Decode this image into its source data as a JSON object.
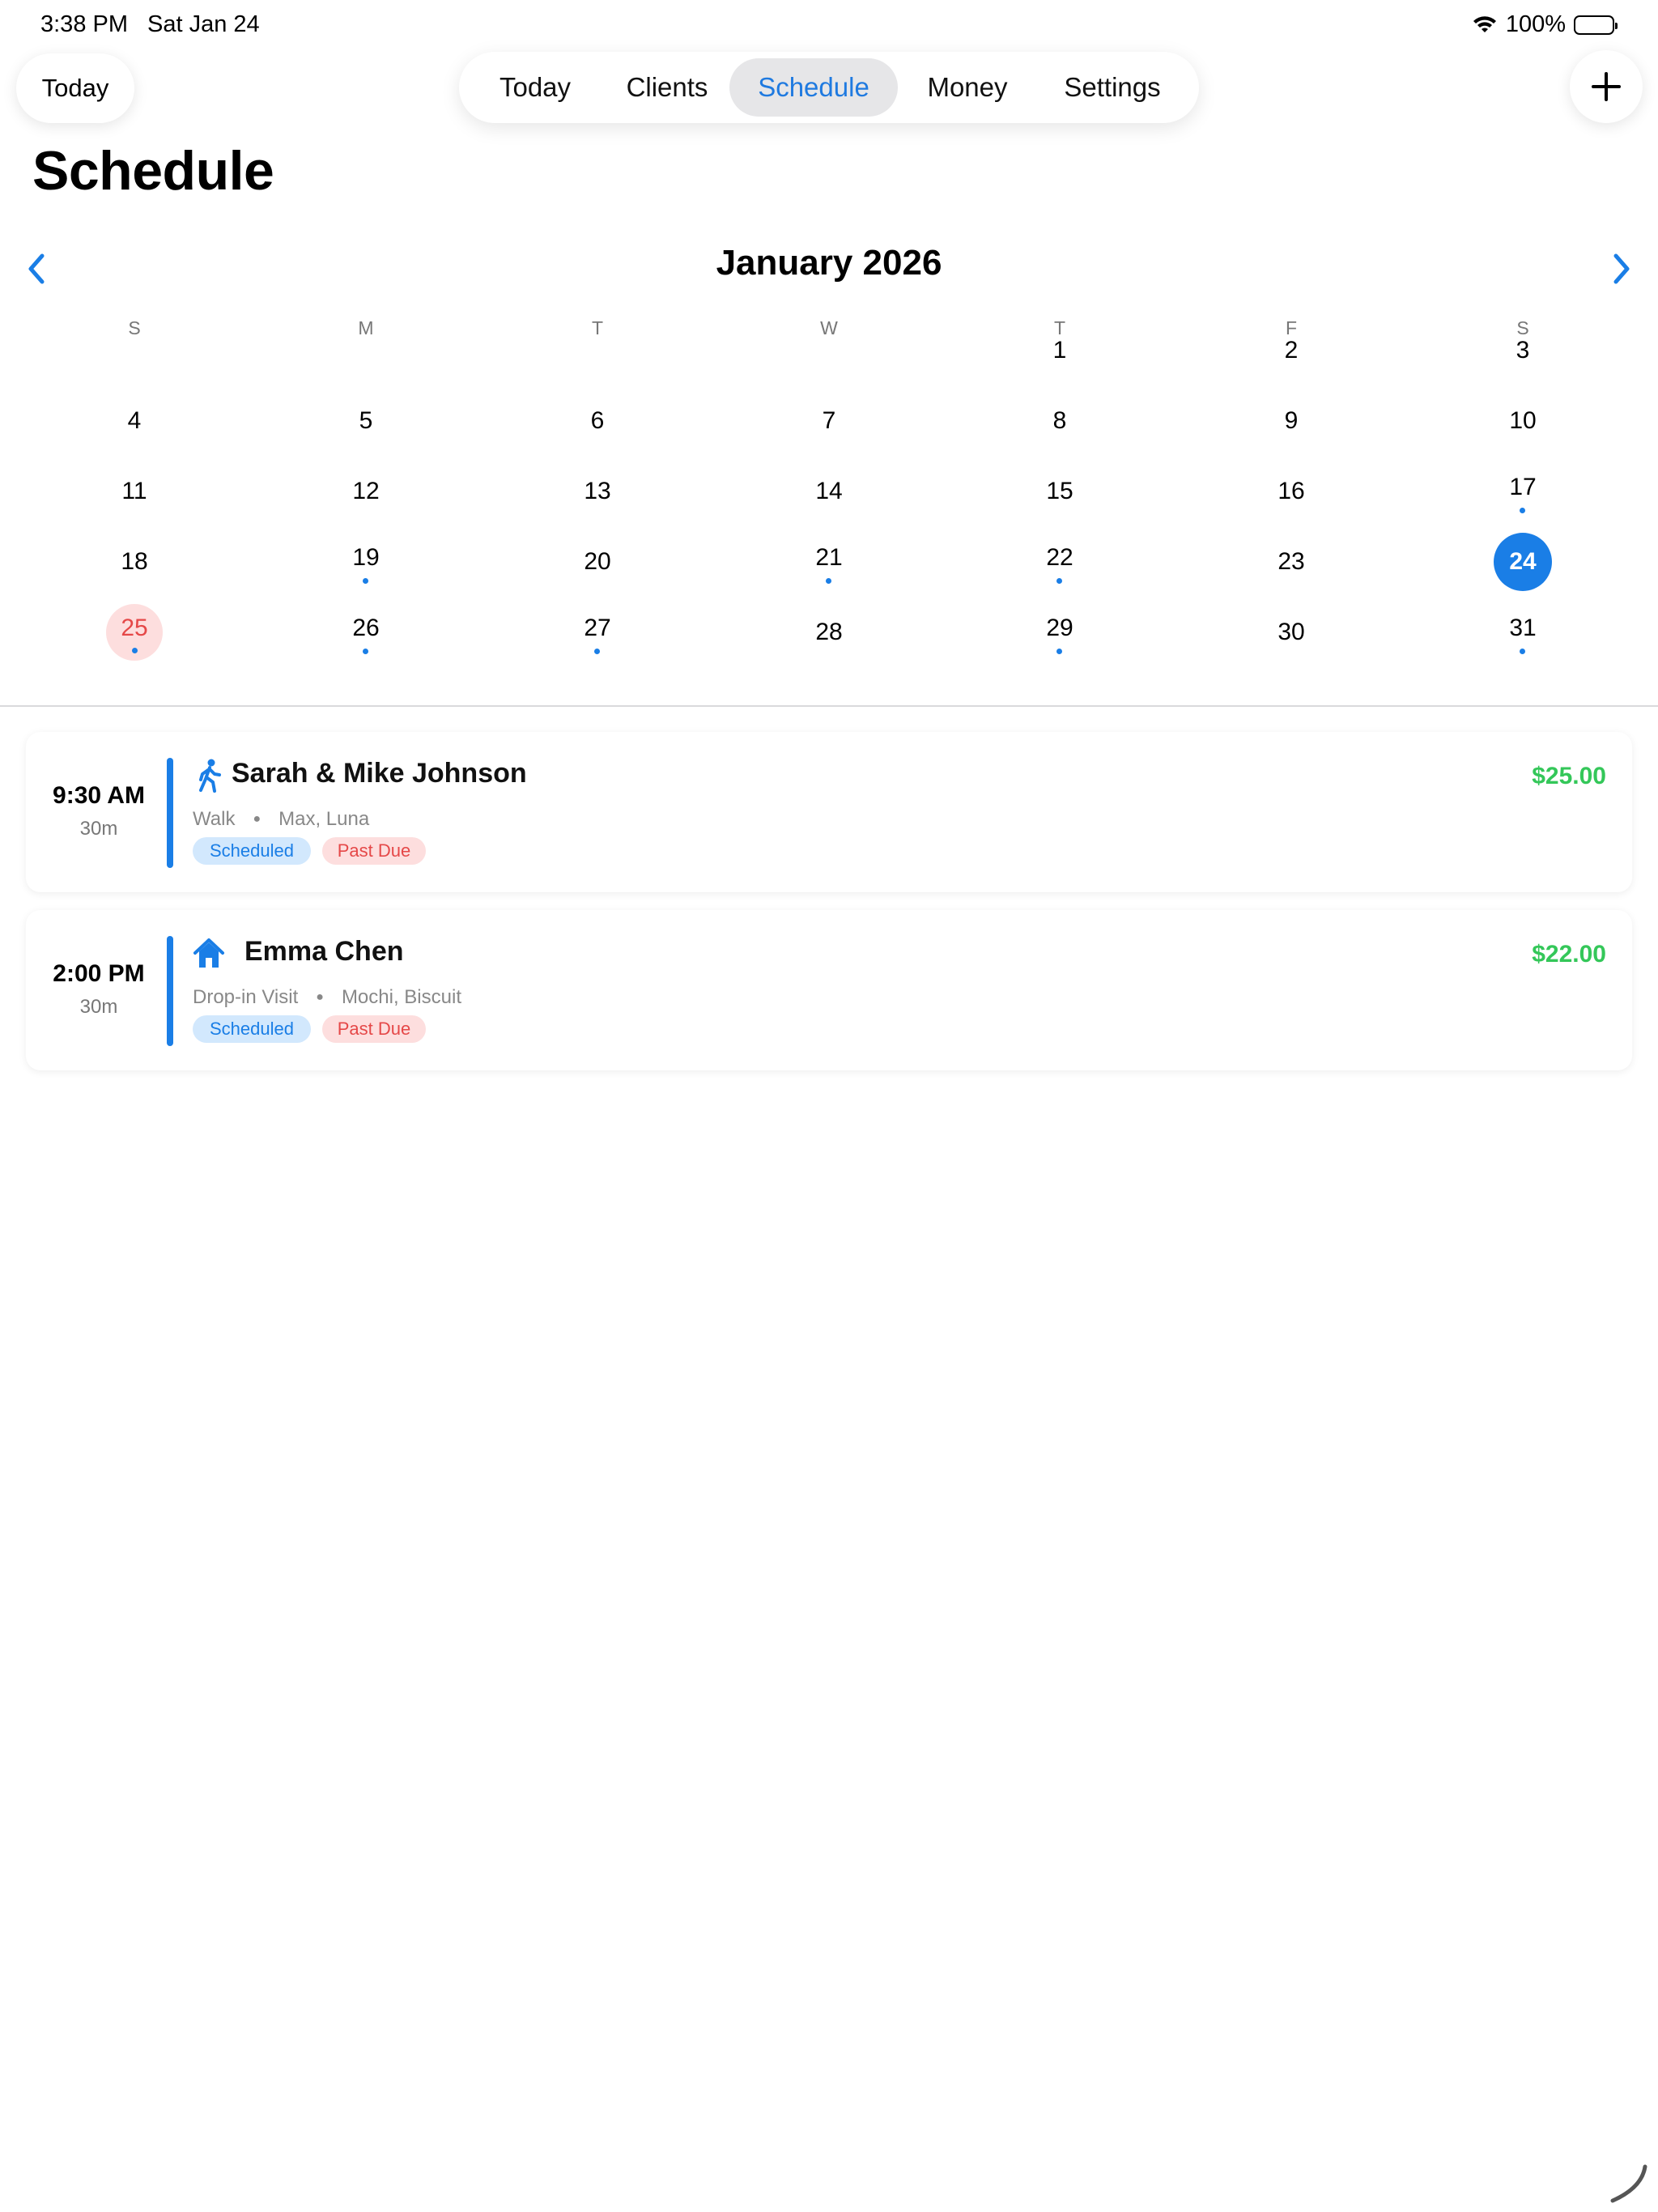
{
  "status_bar": {
    "time": "3:38 PM",
    "date": "Sat Jan 24",
    "battery": "100%"
  },
  "header": {
    "today_button": "Today",
    "tabs": [
      {
        "label": "Today"
      },
      {
        "label": "Clients"
      },
      {
        "label": "Schedule",
        "selected": true
      },
      {
        "label": "Money"
      },
      {
        "label": "Settings"
      }
    ],
    "add_icon": "plus-icon"
  },
  "page": {
    "title": "Schedule"
  },
  "calendar": {
    "month_label": "January 2026",
    "prev_icon": "chevron-left-icon",
    "next_icon": "chevron-right-icon",
    "weekdays": [
      "S",
      "M",
      "T",
      "W",
      "T",
      "F",
      "S"
    ],
    "selected_day": 24,
    "today_day": 25,
    "days_with_events": [
      17,
      19,
      21,
      22,
      25,
      26,
      27,
      29,
      31
    ],
    "weeks": [
      [
        "",
        "",
        "",
        "",
        "1",
        "2",
        "3"
      ],
      [
        "4",
        "5",
        "6",
        "7",
        "8",
        "9",
        "10"
      ],
      [
        "11",
        "12",
        "13",
        "14",
        "15",
        "16",
        "17"
      ],
      [
        "18",
        "19",
        "20",
        "21",
        "22",
        "23",
        "24"
      ],
      [
        "25",
        "26",
        "27",
        "28",
        "29",
        "30",
        "31"
      ]
    ]
  },
  "appointments": [
    {
      "time": "9:30 AM",
      "duration": "30m",
      "icon": "walking-person-icon",
      "client": "Sarah & Mike Johnson",
      "service": "Walk",
      "pets": "Max, Luna",
      "price": "$25.00",
      "badges": [
        "Scheduled",
        "Past Due"
      ]
    },
    {
      "time": "2:00 PM",
      "duration": "30m",
      "icon": "house-icon",
      "client": "Emma Chen",
      "service": "Drop-in Visit",
      "pets": "Mochi, Biscuit",
      "price": "$22.00",
      "badges": [
        "Scheduled",
        "Past Due"
      ]
    }
  ],
  "colors": {
    "accent": "#1a7ee6",
    "price": "#34c759",
    "past_due": "#e54848",
    "today_bg": "#fddede"
  }
}
